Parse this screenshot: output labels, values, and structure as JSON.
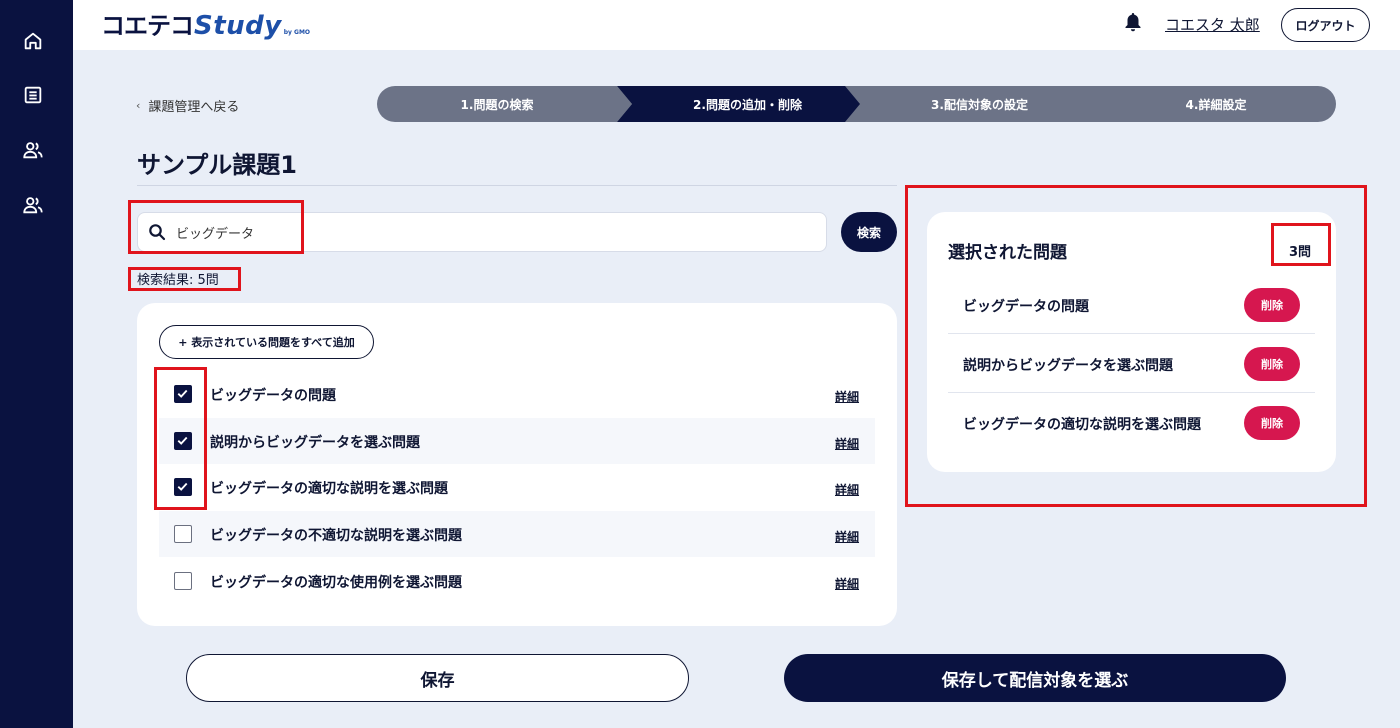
{
  "app": {
    "logo_kana": "コエテコ",
    "logo_study": "Study",
    "logo_by": "by GMO"
  },
  "sidebar": {
    "items": [
      {
        "icon": "home-icon"
      },
      {
        "icon": "list-icon"
      },
      {
        "icon": "users-icon"
      },
      {
        "icon": "users-alt-icon"
      }
    ]
  },
  "header": {
    "user_name": "コエスタ 太郎",
    "logout_label": "ログアウト"
  },
  "nav": {
    "back_label": "課題管理へ戻る"
  },
  "stepper": {
    "steps": [
      {
        "label": "1.問題の検索",
        "active": false
      },
      {
        "label": "2.問題の追加・削除",
        "active": true
      },
      {
        "label": "3.配信対象の設定",
        "active": false
      },
      {
        "label": "4.詳細設定",
        "active": false
      }
    ]
  },
  "page": {
    "title": "サンプル課題1"
  },
  "search": {
    "value": "ビッグデータ",
    "button_label": "検索",
    "result_count": "検索結果: 5問"
  },
  "question_list": {
    "add_all_label": "+ 表示されている問題をすべて追加",
    "detail_label": "詳細",
    "items": [
      {
        "label": "ビッグデータの問題",
        "checked": true
      },
      {
        "label": "説明からビッグデータを選ぶ問題",
        "checked": true
      },
      {
        "label": "ビッグデータの適切な説明を選ぶ問題",
        "checked": true
      },
      {
        "label": "ビッグデータの不適切な説明を選ぶ問題",
        "checked": false
      },
      {
        "label": "ビッグデータの適切な使用例を選ぶ問題",
        "checked": false
      }
    ]
  },
  "selected": {
    "title": "選択された問題",
    "count": "3問",
    "delete_label": "削除",
    "items": [
      {
        "label": "ビッグデータの問題"
      },
      {
        "label": "説明からビッグデータを選ぶ問題"
      },
      {
        "label": "ビッグデータの適切な説明を選ぶ問題"
      }
    ]
  },
  "footer": {
    "save_label": "保存",
    "save_next_label": "保存して配信対象を選ぶ"
  },
  "colors": {
    "navy": "#0a1240",
    "accent_blue": "#1d4fa8",
    "delete_red": "#d6174f",
    "highlight_red": "#e0141c",
    "stepper_gray": "#6c7387",
    "background": "#e9eef7"
  }
}
